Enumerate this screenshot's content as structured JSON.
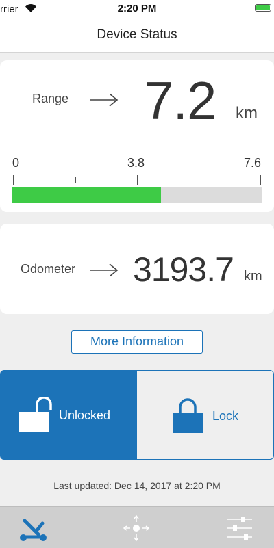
{
  "status_bar": {
    "carrier": "rrier",
    "time": "2:20 PM",
    "battery_color": "#3ecb46"
  },
  "nav": {
    "title": "Device Status"
  },
  "range": {
    "label": "Range",
    "value": "7.2",
    "unit": "km",
    "scale": {
      "min_label": "0",
      "mid_label": "3.8",
      "max_label": "7.6",
      "fill_fraction": 0.595,
      "fill_color": "#3ecb46"
    }
  },
  "odometer": {
    "label": "Odometer",
    "value": "3193.7",
    "unit": "km"
  },
  "more_info_label": "More Information",
  "lock_control": {
    "unlocked_label": "Unlocked",
    "locked_label": "Lock",
    "selected": "unlocked",
    "accent_color": "#1c73b8"
  },
  "last_updated": "Last updated: Dec 14, 2017 at 2:20 PM",
  "tab_bar": {
    "tabs": [
      {
        "icon": "scooter-icon",
        "active": true
      },
      {
        "icon": "move-icon",
        "active": false
      },
      {
        "icon": "sliders-icon",
        "active": false
      }
    ]
  }
}
